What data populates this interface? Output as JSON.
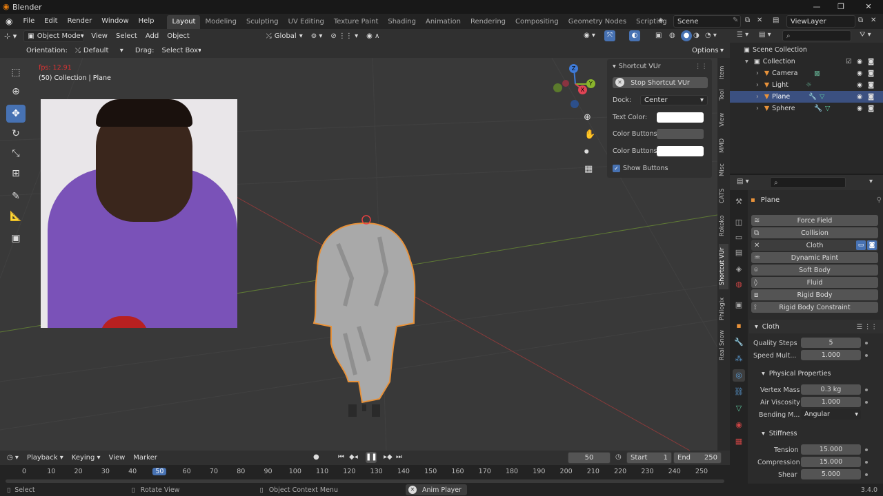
{
  "app": {
    "title": "Blender",
    "version": "3.4.0"
  },
  "menu": [
    "File",
    "Edit",
    "Render",
    "Window",
    "Help"
  ],
  "workspaces": [
    "Layout",
    "Modeling",
    "Sculpting",
    "UV Editing",
    "Texture Paint",
    "Shading",
    "Animation",
    "Rendering",
    "Compositing",
    "Geometry Nodes",
    "Scripting"
  ],
  "scene": "Scene",
  "view_layer": "ViewLayer",
  "viewport_header": {
    "mode": "Object Mode",
    "menus": [
      "View",
      "Select",
      "Add",
      "Object"
    ],
    "orientation_global": "Global",
    "orientation_label": "Orientation:",
    "orientation_value": "Default",
    "drag_label": "Drag:",
    "drag_value": "Select Box",
    "options": "Options"
  },
  "overlay": {
    "fps": "fps: 12.91",
    "info": "(50) Collection | Plane"
  },
  "gizmo": {
    "z": "Z",
    "y": "Y",
    "x": "X"
  },
  "shortcut_panel": {
    "title": "Shortcut VUr",
    "stop_button": "Stop Shortcut VUr",
    "dock_label": "Dock:",
    "dock_value": "Center",
    "text_color_label": "Text Color:",
    "color_buttons_label": "Color Buttons:",
    "color_buttons2_label": "Color Buttons...",
    "show_buttons": "Show Buttons",
    "colors": {
      "text": "#ffffff",
      "buttons": "#545454",
      "buttons2": "#ffffff"
    }
  },
  "side_tabs": [
    "Item",
    "Tool",
    "View",
    "MMD",
    "Misc",
    "CATS",
    "Rokoko",
    "Shortcut VUr",
    "Philogix",
    "Real Snow"
  ],
  "outliner": {
    "root": "Scene Collection",
    "collection": "Collection",
    "items": [
      "Camera",
      "Light",
      "Plane",
      "Sphere"
    ]
  },
  "properties": {
    "object": "Plane",
    "physics_buttons": [
      "Force Field",
      "Collision",
      "Cloth",
      "Dynamic Paint",
      "Soft Body",
      "Fluid",
      "Rigid Body",
      "Rigid Body Constraint"
    ],
    "cloth_section": "Cloth",
    "quality_label": "Quality Steps",
    "quality_value": "5",
    "speed_label": "Speed Mult...",
    "speed_value": "1.000",
    "physical_section": "Physical Properties",
    "mass_label": "Vertex Mass",
    "mass_value": "0.3 kg",
    "air_label": "Air Viscosity",
    "air_value": "1.000",
    "bending_label": "Bending M...",
    "bending_value": "Angular",
    "stiffness_section": "Stiffness",
    "tension_label": "Tension",
    "tension_value": "15.000",
    "compression_label": "Compression",
    "compression_value": "15.000",
    "shear_label": "Shear",
    "shear_value": "5.000"
  },
  "timeline": {
    "menus": [
      "Playback",
      "Keying",
      "View",
      "Marker"
    ],
    "current_frame": "50",
    "start_label": "Start",
    "start_value": "1",
    "end_label": "End",
    "end_value": "250",
    "ticks": [
      "0",
      "10",
      "20",
      "30",
      "40",
      "50",
      "60",
      "70",
      "80",
      "90",
      "100",
      "110",
      "120",
      "130",
      "140",
      "150",
      "160",
      "170",
      "180",
      "190",
      "200",
      "210",
      "220",
      "230",
      "240",
      "250"
    ]
  },
  "status": {
    "select": "Select",
    "rotate": "Rotate View",
    "context": "Object Context Menu",
    "anim": "Anim Player"
  },
  "colors": {
    "accent": "#4772b3",
    "selection": "#3b5080",
    "object_outline": "#e8923a"
  }
}
